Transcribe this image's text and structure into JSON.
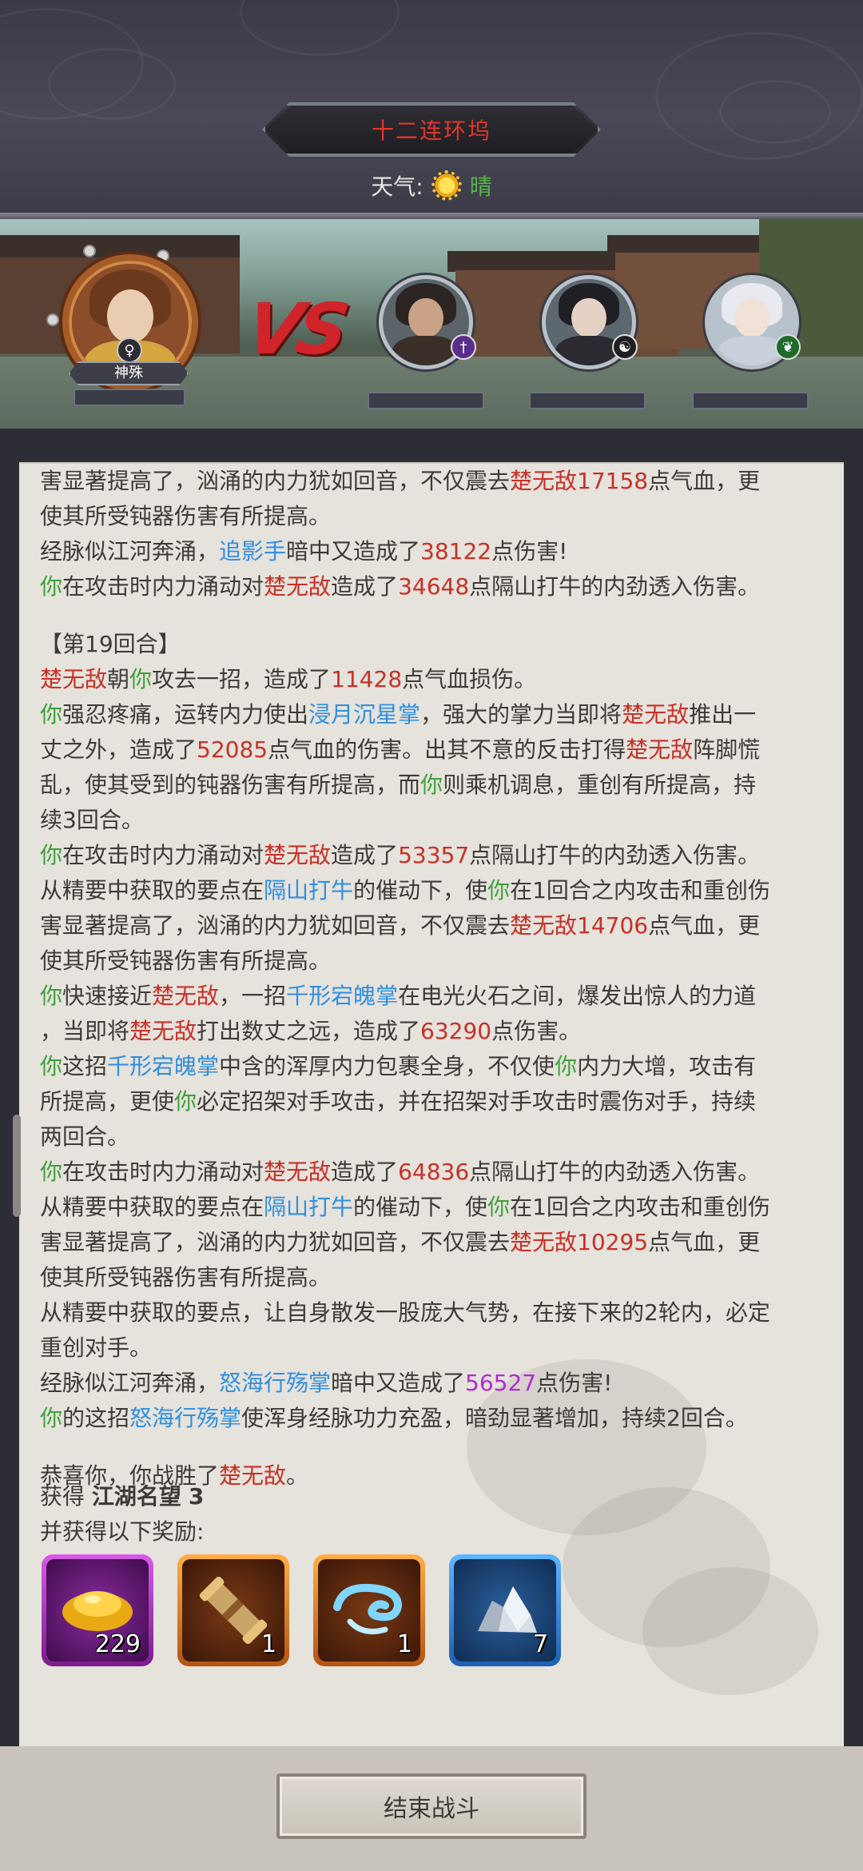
{
  "header": {
    "title": "十二连环坞",
    "weather_label": "天气:",
    "weather_value": "晴",
    "weather_icon": "sun-icon"
  },
  "player": {
    "name": "神殊",
    "element_icon": "female-symbol-icon"
  },
  "enemies": [
    {
      "badge": "sword-icon"
    },
    {
      "badge": "yin-yang-icon"
    },
    {
      "badge": "leaf-icon"
    }
  ],
  "vs_label": "VS",
  "log": [
    [
      [
        "t",
        "害显著提高了，汹涌的内力犹如回音，不仅震去"
      ],
      [
        "r",
        "楚无敌"
      ],
      [
        "r",
        "17158"
      ],
      [
        "t",
        "点气血，更"
      ]
    ],
    [
      [
        "t",
        "使其所受钝器伤害有所提高。"
      ]
    ],
    [
      [
        "t",
        "经脉似江河奔涌，"
      ],
      [
        "b",
        "追影手"
      ],
      [
        "t",
        "暗中又造成了"
      ],
      [
        "r",
        "38122"
      ],
      [
        "t",
        "点伤害!"
      ]
    ],
    [
      [
        "g",
        "你"
      ],
      [
        "t",
        "在攻击时内力涌动对"
      ],
      [
        "r",
        "楚无敌"
      ],
      [
        "t",
        "造成了"
      ],
      [
        "r",
        "34648"
      ],
      [
        "t",
        "点隔山打牛的内劲透入伤害。"
      ]
    ],
    "gap",
    [
      [
        "t",
        "【第19回合】"
      ]
    ],
    [
      [
        "r",
        "楚无敌"
      ],
      [
        "t",
        "朝"
      ],
      [
        "g",
        "你"
      ],
      [
        "t",
        "攻去一招，造成了"
      ],
      [
        "r",
        "11428"
      ],
      [
        "t",
        "点气血损伤。"
      ]
    ],
    [
      [
        "g",
        "你"
      ],
      [
        "t",
        "强忍疼痛，运转内力使出"
      ],
      [
        "b",
        "浸月沉星掌"
      ],
      [
        "t",
        "，强大的掌力当即将"
      ],
      [
        "r",
        "楚无敌"
      ],
      [
        "t",
        "推出一"
      ]
    ],
    [
      [
        "t",
        "丈之外，造成了"
      ],
      [
        "r",
        "52085"
      ],
      [
        "t",
        "点气血的伤害。出其不意的反击打得"
      ],
      [
        "r",
        "楚无敌"
      ],
      [
        "t",
        "阵脚慌"
      ]
    ],
    [
      [
        "t",
        "乱，使其受到的钝器伤害有所提高，而"
      ],
      [
        "g",
        "你"
      ],
      [
        "t",
        "则乘机调息，重创有所提高，持"
      ]
    ],
    [
      [
        "t",
        "续3回合。"
      ]
    ],
    [
      [
        "g",
        "你"
      ],
      [
        "t",
        "在攻击时内力涌动对"
      ],
      [
        "r",
        "楚无敌"
      ],
      [
        "t",
        "造成了"
      ],
      [
        "r",
        "53357"
      ],
      [
        "t",
        "点隔山打牛的内劲透入伤害。"
      ]
    ],
    [
      [
        "t",
        "从精要中获取的要点在"
      ],
      [
        "b",
        "隔山打牛"
      ],
      [
        "t",
        "的催动下，使"
      ],
      [
        "g",
        "你"
      ],
      [
        "t",
        "在1回合之内攻击和重创伤"
      ]
    ],
    [
      [
        "t",
        "害显著提高了，汹涌的内力犹如回音，不仅震去"
      ],
      [
        "r",
        "楚无敌"
      ],
      [
        "r",
        "14706"
      ],
      [
        "t",
        "点气血，更"
      ]
    ],
    [
      [
        "t",
        "使其所受钝器伤害有所提高。"
      ]
    ],
    [
      [
        "g",
        "你"
      ],
      [
        "t",
        "快速接近"
      ],
      [
        "r",
        "楚无敌"
      ],
      [
        "t",
        "，一招"
      ],
      [
        "b",
        "千形宕魄掌"
      ],
      [
        "t",
        "在电光火石之间，爆发出惊人的力道"
      ]
    ],
    [
      [
        "t",
        "，当即将"
      ],
      [
        "r",
        "楚无敌"
      ],
      [
        "t",
        "打出数丈之远，造成了"
      ],
      [
        "r",
        "63290"
      ],
      [
        "t",
        "点伤害。"
      ]
    ],
    [
      [
        "g",
        "你"
      ],
      [
        "t",
        "这招"
      ],
      [
        "b",
        "千形宕魄掌"
      ],
      [
        "t",
        "中含的浑厚内力包裹全身，不仅使"
      ],
      [
        "g",
        "你"
      ],
      [
        "t",
        "内力大增，攻击有"
      ]
    ],
    [
      [
        "t",
        "所提高，更使"
      ],
      [
        "g",
        "你"
      ],
      [
        "t",
        "必定招架对手攻击，并在招架对手攻击时震伤对手，持续"
      ]
    ],
    [
      [
        "t",
        "两回合。"
      ]
    ],
    [
      [
        "g",
        "你"
      ],
      [
        "t",
        "在攻击时内力涌动对"
      ],
      [
        "r",
        "楚无敌"
      ],
      [
        "t",
        "造成了"
      ],
      [
        "r",
        "64836"
      ],
      [
        "t",
        "点隔山打牛的内劲透入伤害。"
      ]
    ],
    [
      [
        "t",
        "从精要中获取的要点在"
      ],
      [
        "b",
        "隔山打牛"
      ],
      [
        "t",
        "的催动下，使"
      ],
      [
        "g",
        "你"
      ],
      [
        "t",
        "在1回合之内攻击和重创伤"
      ]
    ],
    [
      [
        "t",
        "害显著提高了，汹涌的内力犹如回音，不仅震去"
      ],
      [
        "r",
        "楚无敌"
      ],
      [
        "r",
        "10295"
      ],
      [
        "t",
        "点气血，更"
      ]
    ],
    [
      [
        "t",
        "使其所受钝器伤害有所提高。"
      ]
    ],
    [
      [
        "t",
        "从精要中获取的要点，让自身散发一股庞大气势，在接下来的2轮内，必定"
      ]
    ],
    [
      [
        "t",
        "重创对手。"
      ]
    ],
    [
      [
        "t",
        "经脉似江河奔涌，"
      ],
      [
        "b",
        "怒海行殇掌"
      ],
      [
        "t",
        "暗中又造成了"
      ],
      [
        "p",
        "56527"
      ],
      [
        "t",
        "点伤害!"
      ]
    ],
    [
      [
        "g",
        "你"
      ],
      [
        "t",
        "的这招"
      ],
      [
        "b",
        "怒海行殇掌"
      ],
      [
        "t",
        "使浑身经脉功力充盈，暗劲显著增加，持续2回合。"
      ]
    ],
    "gap",
    [
      [
        "t",
        "恭喜你，你战胜了"
      ],
      [
        "r",
        "楚无敌"
      ],
      [
        "t",
        "。"
      ]
    ]
  ],
  "rewards": {
    "fame_prefix": "获得",
    "fame_name": "江湖名望",
    "fame_value": "3",
    "items_label": "并获得以下奖励:",
    "items": [
      {
        "icon": "gold-ingot-icon",
        "qty": "229",
        "rarity": "purple"
      },
      {
        "icon": "scroll-icon",
        "qty": "1",
        "rarity": "orange"
      },
      {
        "icon": "cloud-swirl-icon",
        "qty": "1",
        "rarity": "orange"
      },
      {
        "icon": "crystal-ore-icon",
        "qty": "7",
        "rarity": "blue"
      }
    ]
  },
  "end_button": "结束战斗"
}
